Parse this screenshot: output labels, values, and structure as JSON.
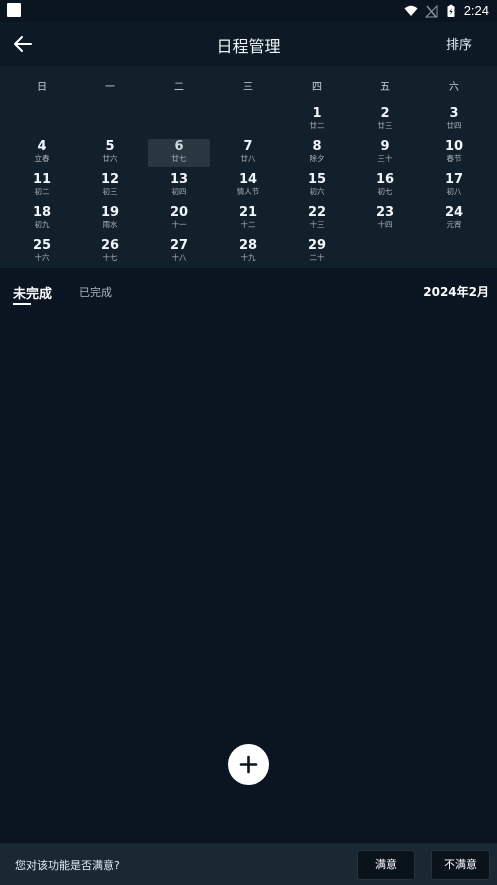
{
  "status_bar": {
    "time": "2:24"
  },
  "app_bar": {
    "title": "日程管理",
    "sort_label": "排序"
  },
  "calendar": {
    "weekdays": [
      "日",
      "一",
      "二",
      "三",
      "四",
      "五",
      "六"
    ],
    "weeks": [
      [
        null,
        null,
        null,
        null,
        {
          "day": "1",
          "lunar": "廿二"
        },
        {
          "day": "2",
          "lunar": "廿三"
        },
        {
          "day": "3",
          "lunar": "廿四"
        }
      ],
      [
        {
          "day": "4",
          "lunar": "立春"
        },
        {
          "day": "5",
          "lunar": "廿六"
        },
        {
          "day": "6",
          "lunar": "廿七",
          "selected": true
        },
        {
          "day": "7",
          "lunar": "廿八"
        },
        {
          "day": "8",
          "lunar": "除夕"
        },
        {
          "day": "9",
          "lunar": "三十"
        },
        {
          "day": "10",
          "lunar": "春节"
        }
      ],
      [
        {
          "day": "11",
          "lunar": "初二"
        },
        {
          "day": "12",
          "lunar": "初三"
        },
        {
          "day": "13",
          "lunar": "初四"
        },
        {
          "day": "14",
          "lunar": "情人节"
        },
        {
          "day": "15",
          "lunar": "初六"
        },
        {
          "day": "16",
          "lunar": "初七"
        },
        {
          "day": "17",
          "lunar": "初八"
        }
      ],
      [
        {
          "day": "18",
          "lunar": "初九"
        },
        {
          "day": "19",
          "lunar": "雨水"
        },
        {
          "day": "20",
          "lunar": "十一"
        },
        {
          "day": "21",
          "lunar": "十二"
        },
        {
          "day": "22",
          "lunar": "十三"
        },
        {
          "day": "23",
          "lunar": "十四"
        },
        {
          "day": "24",
          "lunar": "元宵"
        }
      ],
      [
        {
          "day": "25",
          "lunar": "十六"
        },
        {
          "day": "26",
          "lunar": "十七"
        },
        {
          "day": "27",
          "lunar": "十八"
        },
        {
          "day": "28",
          "lunar": "十九"
        },
        {
          "day": "29",
          "lunar": "二十"
        },
        null,
        null
      ]
    ]
  },
  "tabs": {
    "active_label": "未完成",
    "inactive_label": "已完成",
    "month_label": "2024年2月"
  },
  "add_button": {
    "icon": "plus-icon"
  },
  "feedback": {
    "question": "您对该功能是否满意?",
    "satisfied_label": "满意",
    "unsatisfied_label": "不满意"
  }
}
